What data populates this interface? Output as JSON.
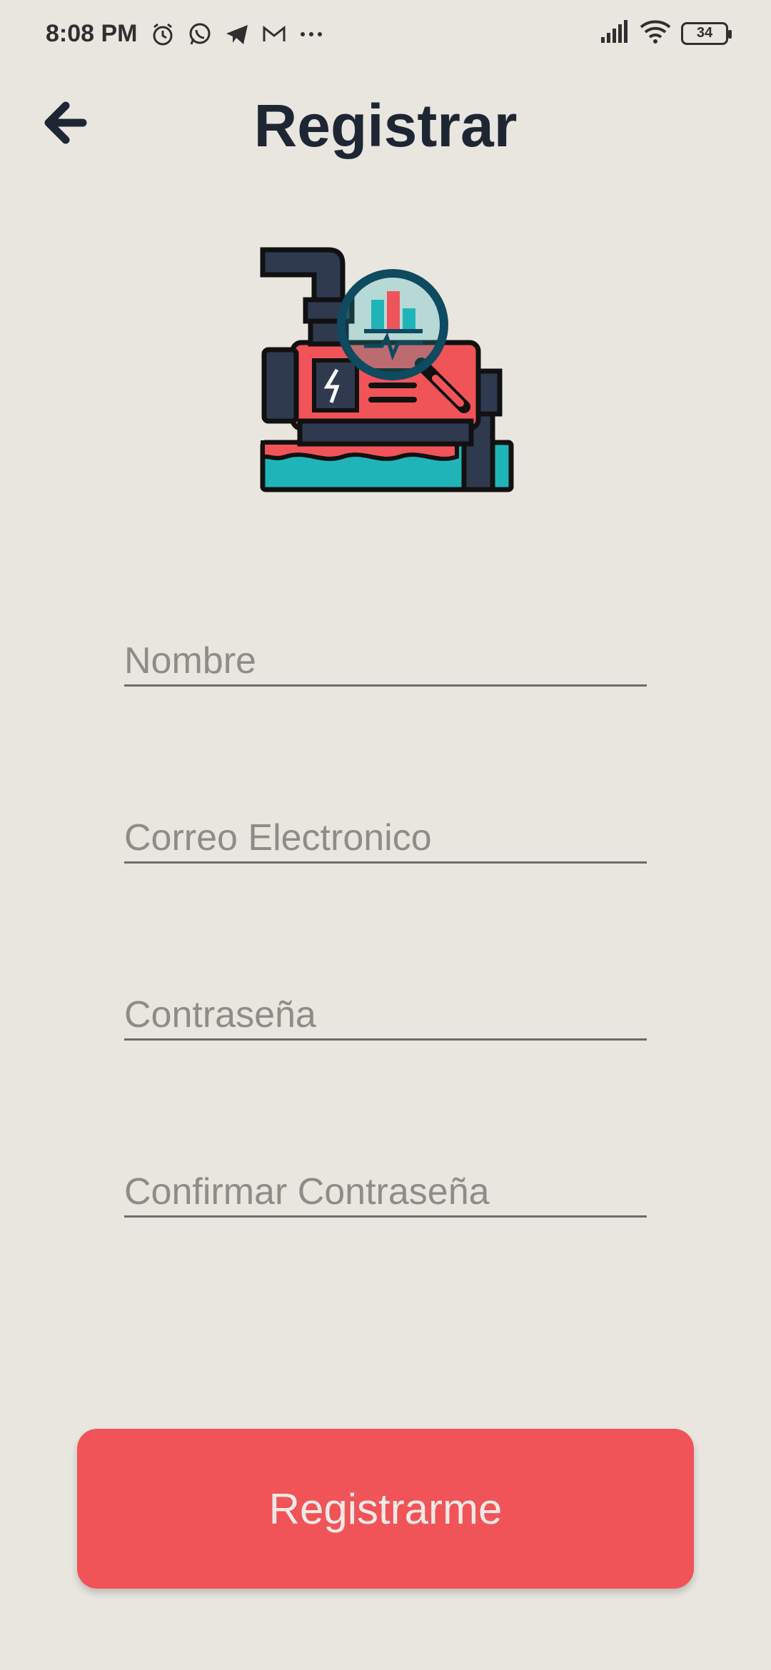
{
  "status_bar": {
    "time": "8:08 PM",
    "battery": "34",
    "left_icons": [
      "alarm-icon",
      "whatsapp-icon",
      "telegram-icon",
      "gmail-icon",
      "more-dots-icon"
    ],
    "right_icons": [
      "signal-icon",
      "wifi-icon",
      "battery-icon"
    ]
  },
  "header": {
    "title": "Registrar",
    "back_icon": "arrow-left-icon"
  },
  "illustration": {
    "icon": "water-pump-monitor-icon",
    "colors": {
      "primary": "#f05458",
      "dark": "#2f3a4f",
      "water": "#1fb5b8",
      "outline": "#111111"
    }
  },
  "form": {
    "name_placeholder": "Nombre",
    "email_placeholder": "Correo Electronico",
    "password_placeholder": "Contraseña",
    "confirm_password_placeholder": "Confirmar Contraseña"
  },
  "submit": {
    "label": "Registrarme",
    "color": "#f05458"
  },
  "theme": {
    "background": "#e8e6df",
    "title_color": "#1f2633"
  }
}
